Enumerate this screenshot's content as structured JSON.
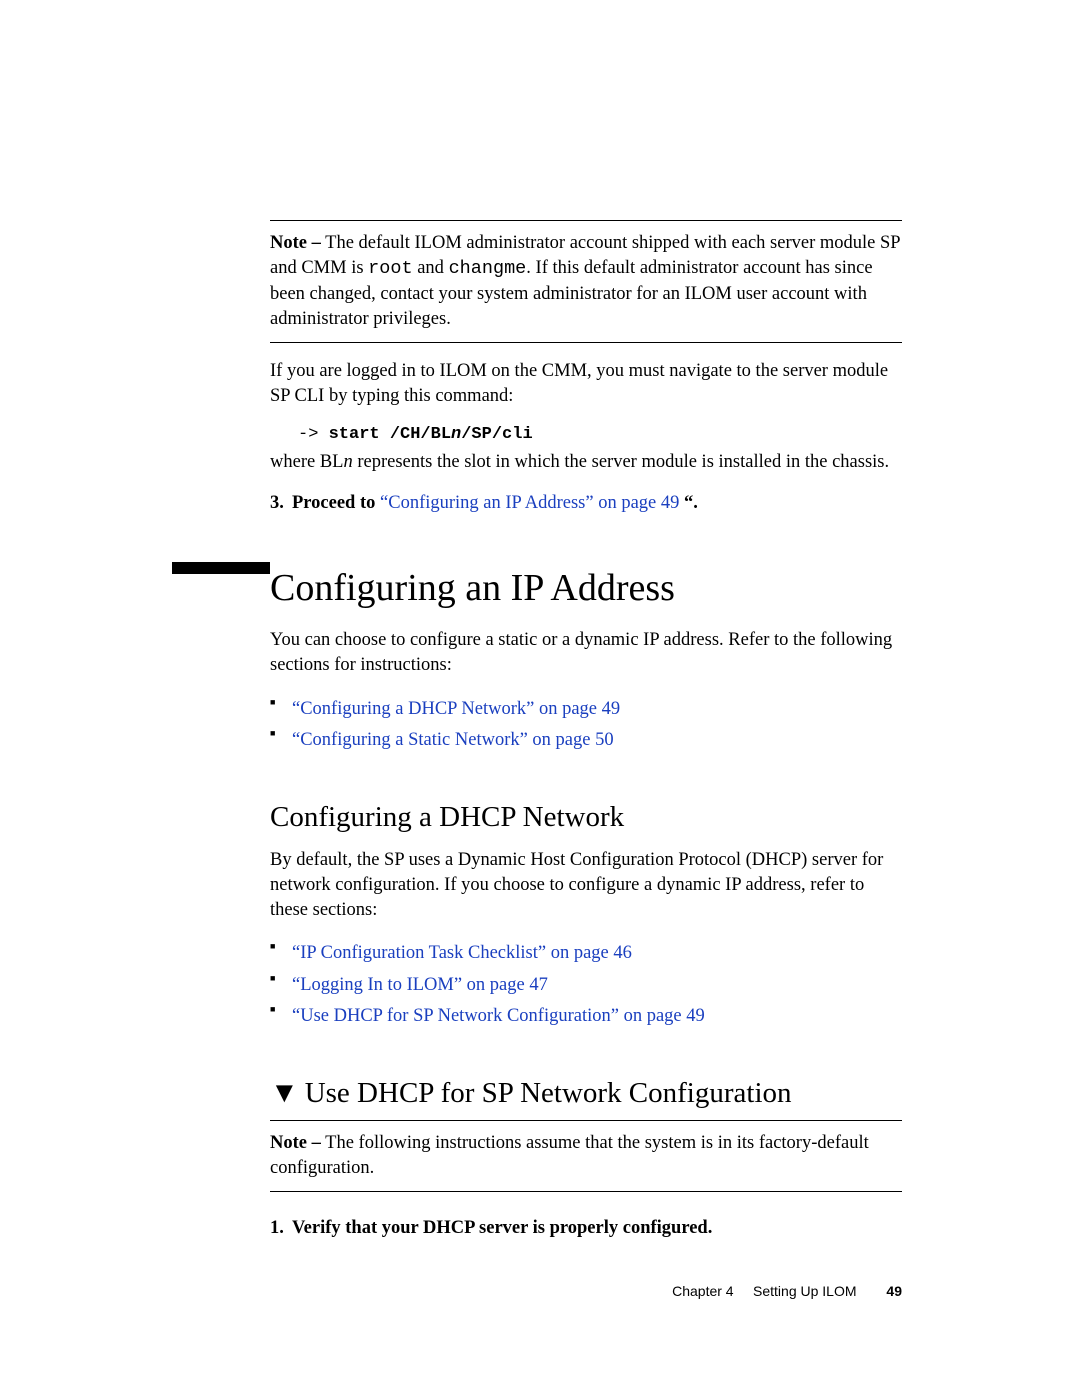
{
  "note1": {
    "label": "Note –",
    "text_before_root": " The default ILOM administrator account shipped with each server module SP and CMM is ",
    "root": "root",
    "and": " and ",
    "changme": "changme",
    "text_after": ". If this default administrator account has since been changed, contact your system administrator for an ILOM user account with administrator privileges."
  },
  "logged_in_text": "If you are logged in to ILOM on the CMM, you must navigate to the server module SP CLI by typing this command:",
  "cmd": {
    "arrow": "->",
    "p1": " start /CH/BL",
    "n": "n",
    "p2": "/SP/cli"
  },
  "where_text_1": "where BL",
  "where_n": "n",
  "where_text_2": " represents the slot in which the server module is installed in the chassis.",
  "step3": {
    "num": "3.",
    "proceed": "Proceed to ",
    "link": "“Configuring an IP Address” on page 49",
    "tail": " “."
  },
  "h1": "Configuring an IP Address",
  "h1_intro": "You can choose to configure a static or a dynamic IP address. Refer to the following sections for instructions:",
  "h1_links": [
    "“Configuring a DHCP Network” on page 49",
    "“Configuring a Static Network” on page 50"
  ],
  "h2_dhcp": "Configuring a DHCP Network",
  "h2_dhcp_intro": "By default, the SP uses a Dynamic Host Configuration Protocol (DHCP) server for network configuration. If you choose to configure a dynamic IP address, refer to these sections:",
  "h2_dhcp_links": [
    "“IP Configuration Task Checklist” on page 46",
    "“Logging In to ILOM” on page 47",
    "“Use DHCP for SP Network Configuration” on page 49"
  ],
  "h2_proc": "Use DHCP for SP Network Configuration",
  "note2": {
    "label": "Note –",
    "text": " The following instructions assume that the system is in its factory-default configuration."
  },
  "step1": {
    "num": "1.",
    "text": "Verify that your DHCP server is properly configured."
  },
  "footer": {
    "chapter": "Chapter 4",
    "title": "Setting Up ILOM",
    "page": "49"
  }
}
